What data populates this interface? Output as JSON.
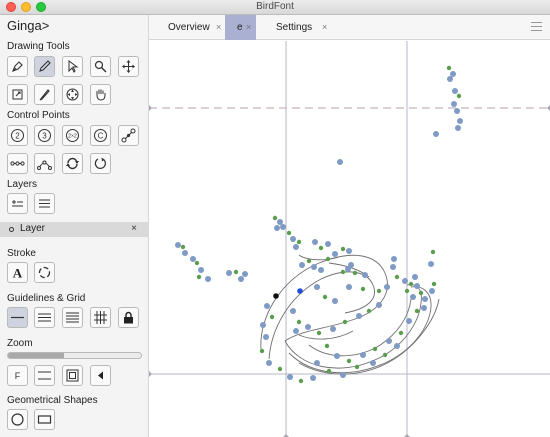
{
  "window": {
    "title": "BirdFont"
  },
  "app": {
    "name": "Ginga>"
  },
  "tabs": [
    {
      "label": "Overview",
      "close": "×"
    },
    {
      "label": "e",
      "close": "×"
    },
    {
      "label": "Settings",
      "close": "×"
    }
  ],
  "sidebar": {
    "drawing_tools": "Drawing Tools",
    "control_points": "Control Points",
    "layers": "Layers",
    "layer_item": {
      "label": "Layer",
      "close": "×"
    },
    "stroke": "Stroke",
    "guidelines": "Guidelines & Grid",
    "zoom": "Zoom",
    "geometrical_shapes": "Geometrical Shapes"
  },
  "tool_text": {
    "two": "2",
    "three": "3",
    "two_x_two": "2×2",
    "c": "C",
    "stroke_letter": "A",
    "zoom_f": "F"
  },
  "zoom": {
    "level": 0.42
  },
  "colors": {
    "point_blue": "#7f9ac4",
    "point_green": "#5b9e4d",
    "selected_blue": "#1f4fd6",
    "guide_gray": "#b7b7c8",
    "guide_dash": "#c7b3c0",
    "tab_active": "#a9b0d1"
  }
}
